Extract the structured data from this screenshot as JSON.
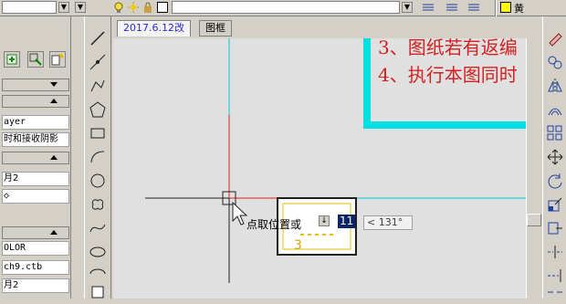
{
  "colors": {
    "accent_cyan": "#00e0e0",
    "red": "#d42020",
    "blue_text": "#2a2ad0"
  },
  "tabs": [
    "2017.6.12改",
    "图框"
  ],
  "left_panel": {
    "rows": [
      "ayer",
      "时和接收阴影",
      "月2",
      "◇",
      "OLOR",
      "ch9.ctb",
      "月2"
    ]
  },
  "canvas": {
    "text_lines": [
      "3、图纸若有返编",
      "4、执行本图同时"
    ],
    "command_prompt": "点取位置或",
    "coord_value": "11",
    "angle_readout": "< 131°"
  },
  "top_bar": {
    "color_label": "黄"
  },
  "icons": {
    "draw_tools": [
      "line-icon",
      "xline-icon",
      "polyline-icon",
      "polygon-icon",
      "rectangle-icon",
      "arc-icon",
      "circle-icon",
      "revcloud-icon",
      "spline-icon",
      "ellipse-icon",
      "ellipse-arc-icon",
      "insert-block-icon"
    ],
    "modify_tools": [
      "erase-icon",
      "copy-icon",
      "mirror-icon",
      "offset-icon",
      "array-icon",
      "move-icon",
      "rotate-icon",
      "scale-icon",
      "stretch-icon",
      "trim-icon",
      "extend-icon"
    ]
  }
}
